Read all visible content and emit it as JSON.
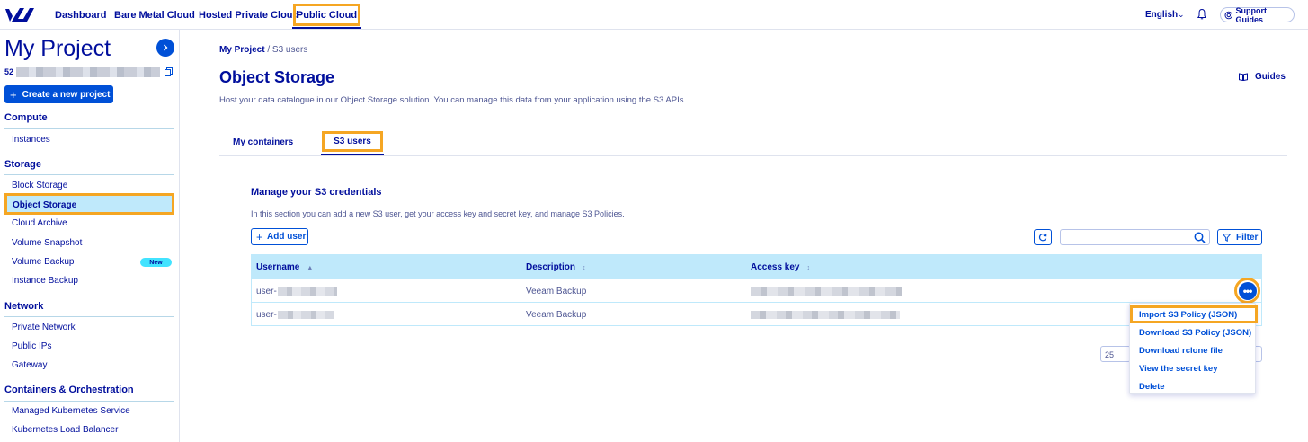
{
  "topbar": {
    "nav": [
      "Dashboard",
      "Bare Metal Cloud",
      "Hosted Private Cloud",
      "Public Cloud"
    ],
    "language": "English",
    "support": "Support Guides"
  },
  "sidebar": {
    "project_title": "My Project",
    "project_id_prefix": "52",
    "new_project": "Create a new project",
    "sections": {
      "compute": "Compute",
      "storage": "Storage",
      "network": "Network",
      "containers": "Containers & Orchestration"
    },
    "items": {
      "instances": "Instances",
      "block_storage": "Block Storage",
      "object_storage": "Object Storage",
      "cloud_archive": "Cloud Archive",
      "volume_snapshot": "Volume Snapshot",
      "volume_backup": "Volume Backup",
      "instance_backup": "Instance Backup",
      "private_network": "Private Network",
      "public_ips": "Public IPs",
      "gateway": "Gateway",
      "managed_k8s": "Managed Kubernetes Service",
      "k8s_lb": "Kubernetes Load Balancer"
    },
    "new_badge": "New"
  },
  "main": {
    "breadcrumb_root": "My Project",
    "breadcrumb_sep": "/",
    "breadcrumb_current": "S3 users",
    "title": "Object Storage",
    "guides": "Guides",
    "description": "Host your data catalogue in our Object Storage solution. You can manage this data from your application using the S3 APIs.",
    "tabs": [
      "My containers",
      "S3 users"
    ],
    "section_title": "Manage your S3 credentials",
    "section_desc": "In this section you can add a new S3 user, get your access key and secret key, and manage S3 Policies.",
    "add_user": "Add user",
    "filter": "Filter",
    "search_value": "",
    "table": {
      "columns": [
        "Username",
        "Description",
        "Access key"
      ],
      "rows": [
        {
          "username": "user-",
          "description": "Veeam Backup"
        },
        {
          "username": "user-",
          "description": "Veeam Backup"
        }
      ]
    },
    "page_size": "25",
    "actions_menu": [
      "Import S3 Policy (JSON)",
      "Download S3 Policy (JSON)",
      "Download rclone file",
      "View the secret key",
      "Delete"
    ]
  },
  "colors": {
    "brand": "#000e9c",
    "primary": "#0050d7",
    "highlight": "#f5a623",
    "table_header": "#bfe9fb",
    "badge": "#42e3ff"
  }
}
